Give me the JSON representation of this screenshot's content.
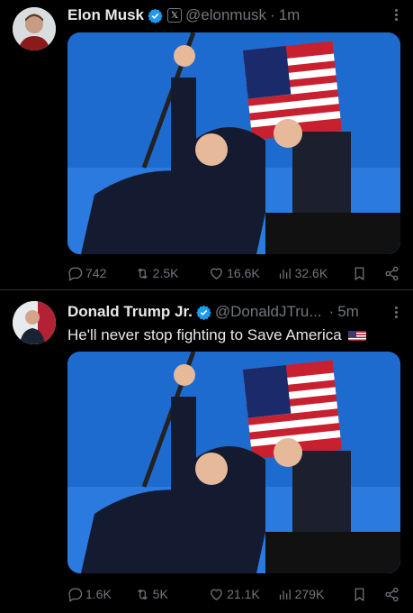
{
  "posts": [
    {
      "author": "Elon Musk",
      "handle": "@elonmusk",
      "time": "1m",
      "affiliate_badge": "𝕏",
      "text": "",
      "stats": {
        "replies": "742",
        "reposts": "2.5K",
        "likes": "16.6K",
        "views": "32.6K"
      }
    },
    {
      "author": "Donald Trump Jr.",
      "handle": "@DonaldJTru...",
      "time": "5m",
      "text": "He'll never stop fighting to Save America",
      "stats": {
        "replies": "1.6K",
        "reposts": "5K",
        "likes": "21.1K",
        "views": "279K"
      }
    }
  ],
  "icons": {
    "verified": "verified-badge-icon",
    "reply": "reply-icon",
    "repost": "repost-icon",
    "like": "heart-icon",
    "views": "views-icon",
    "bookmark": "bookmark-icon",
    "share": "share-icon",
    "more": "more-icon"
  },
  "colors": {
    "background": "#000000",
    "text": "#e7e9ea",
    "muted": "#71767b",
    "verified": "#1d9bf0",
    "sky": "#1f6fd0"
  }
}
